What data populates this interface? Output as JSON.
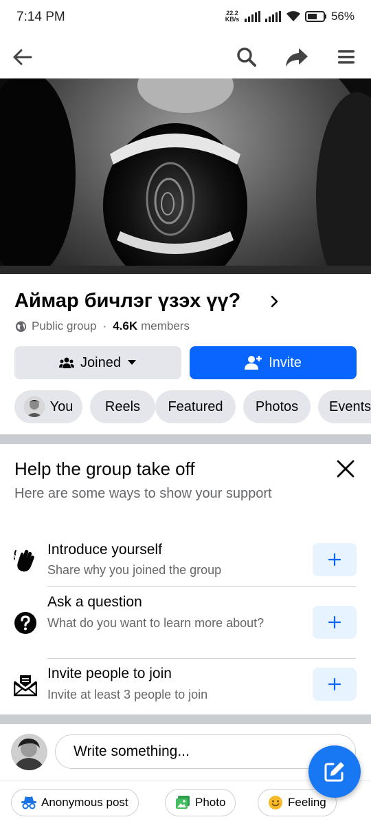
{
  "status_bar": {
    "time": "7:14 PM",
    "net_speed_value": "22.2",
    "net_speed_unit": "KB/s",
    "battery": "56%"
  },
  "top_nav": {
    "icons": [
      "back-arrow-icon",
      "search-icon",
      "share-icon",
      "menu-icon"
    ]
  },
  "group": {
    "title": "Аймар бичлэг үзэх үү?",
    "privacy": "Public group",
    "separator": "·",
    "members_count": "4.6K",
    "members_label": "members"
  },
  "actions": {
    "joined_label": "Joined",
    "invite_label": "Invite"
  },
  "tabs": [
    {
      "label": "You",
      "has_avatar": true
    },
    {
      "label": "Reels"
    },
    {
      "label": "Featured"
    },
    {
      "label": "Photos"
    },
    {
      "label": "Events"
    }
  ],
  "help_card": {
    "title": "Help the group take off",
    "subtitle": "Here are some ways to show your support",
    "tasks": [
      {
        "title": "Introduce yourself",
        "description": "Share why you joined the group",
        "icon": "waving-hand-icon"
      },
      {
        "title": "Ask a question",
        "description": "What do you want to learn more about?",
        "icon": "question-icon"
      },
      {
        "title": "Invite people to join",
        "description": "Invite at least 3 people to join",
        "icon": "envelope-icon"
      }
    ]
  },
  "composer": {
    "placeholder": "Write something..."
  },
  "post_options": [
    {
      "label": "Anonymous post",
      "icon": "anonymous-icon"
    },
    {
      "label": "Photo",
      "icon": "photo-icon"
    },
    {
      "label": "Feeling",
      "icon": "feeling-icon"
    }
  ],
  "colors": {
    "accent": "#0866ff",
    "fab": "#1877f2",
    "chip_bg": "#e4e6eb",
    "secondary_text": "#65676b",
    "add_button_bg": "#e7f3ff"
  }
}
